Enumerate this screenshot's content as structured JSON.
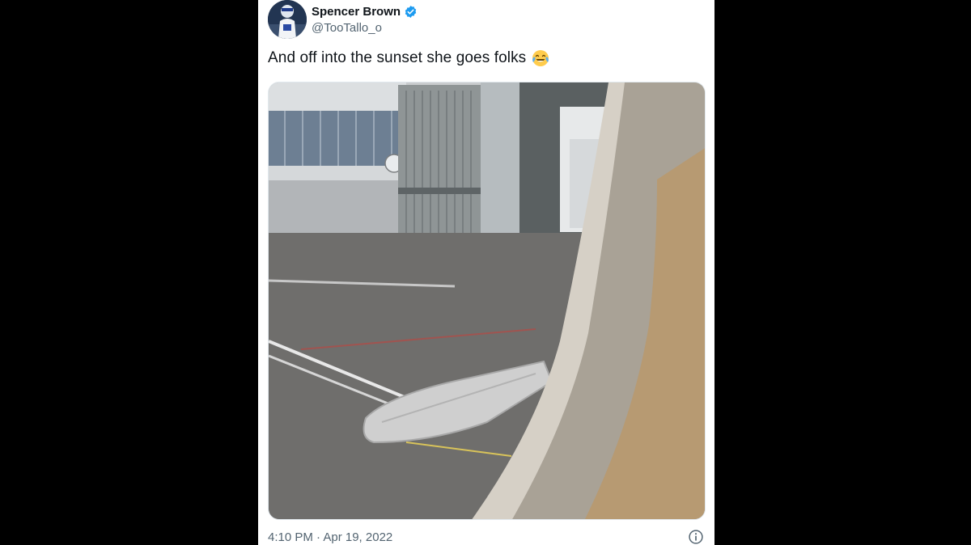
{
  "tweet": {
    "author_name": "Spencer Brown",
    "author_handle": "@TooTallo_o",
    "text": "And off into the sunset she goes folks",
    "emoji_icon": "face-with-tears-of-joy-icon",
    "timestamp": "4:10 PM · Apr 19, 2022",
    "verified_icon": "verified-badge-icon",
    "info_icon": "info-icon"
  },
  "colors": {
    "background": "#000000",
    "card": "#ffffff",
    "name": "#0f1419",
    "secondary": "#536471",
    "verified": "#1d9bf0"
  }
}
